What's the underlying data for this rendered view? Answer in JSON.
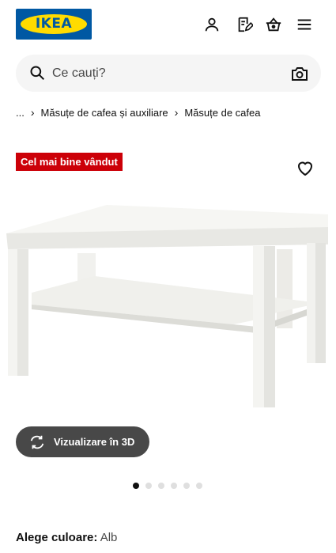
{
  "header": {
    "logo_text": "IKEA",
    "icons": [
      "user-icon",
      "shopping-list-icon",
      "basket-icon",
      "menu-icon"
    ]
  },
  "search": {
    "placeholder": "Ce cauți?",
    "icons": [
      "search-icon",
      "camera-icon"
    ]
  },
  "breadcrumb": {
    "items": [
      "...",
      "Măsuțe de cafea și auxiliare",
      "Măsuțe de cafea"
    ]
  },
  "product": {
    "badge": "Cel mai bine vândut",
    "view_3d_label": "Vizualizare în 3D",
    "carousel": {
      "total": 6,
      "active": 1
    },
    "color_label": "Alege culoare:",
    "color_value": "Alb"
  },
  "colors": {
    "brand_blue": "#0058a3",
    "brand_yellow": "#ffdb00",
    "badge_red": "#cc0008",
    "button_dark": "#484848"
  }
}
